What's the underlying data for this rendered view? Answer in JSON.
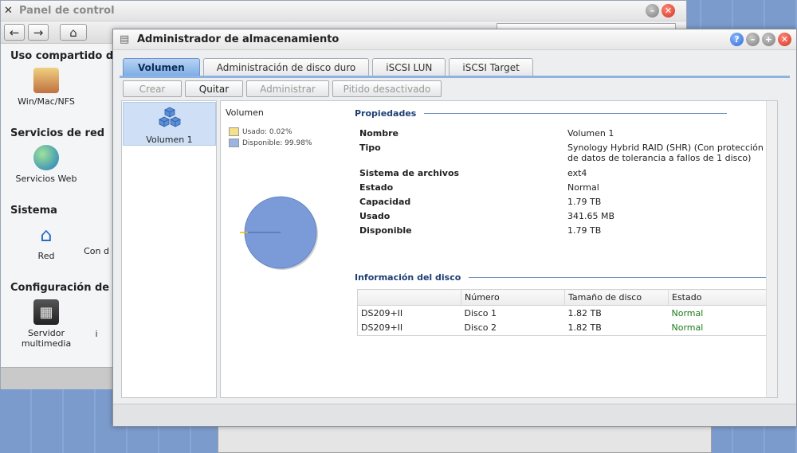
{
  "control_panel": {
    "title": "Panel de control",
    "sections": [
      {
        "label": "Uso compartido de",
        "items": [
          "Win/Mac/NFS"
        ]
      },
      {
        "label": "Servicios de red",
        "items": [
          "Servicios Web"
        ]
      },
      {
        "label": "Sistema",
        "items": [
          "Red",
          "Con d"
        ]
      },
      {
        "label": "Configuración de la",
        "items": [
          "Servidor multimedia",
          "i"
        ]
      }
    ]
  },
  "storage_manager": {
    "title": "Administrador de almacenamiento",
    "tabs": [
      "Volumen",
      "Administración de disco duro",
      "iSCSI LUN",
      "iSCSI Target"
    ],
    "actions": [
      {
        "label": "Crear",
        "enabled": false
      },
      {
        "label": "Quitar",
        "enabled": true
      },
      {
        "label": "Administrar",
        "enabled": false
      },
      {
        "label": "Pitido desactivado",
        "enabled": false
      }
    ],
    "volume_list": [
      "Volumen 1"
    ],
    "chart": {
      "title": "Volumen",
      "legend": [
        {
          "label": "Usado: 0.02%",
          "color": "#f7e08a"
        },
        {
          "label": "Disponible: 99.98%",
          "color": "#9ab5e0"
        }
      ]
    },
    "properties_title": "Propiedades",
    "properties": [
      {
        "key": "Nombre",
        "value": "Volumen 1"
      },
      {
        "key": "Tipo",
        "value": "Synology Hybrid RAID (SHR) (Con protección de datos de tolerancia a fallos de 1 disco)"
      },
      {
        "key": "Sistema de archivos",
        "value": "ext4"
      },
      {
        "key": "Estado",
        "value": "Normal"
      },
      {
        "key": "Capacidad",
        "value": "1.79 TB"
      },
      {
        "key": "Usado",
        "value": "341.65 MB"
      },
      {
        "key": "Disponible",
        "value": "1.79 TB"
      }
    ],
    "disk_info_title": "Información del disco",
    "disk_table": {
      "headers": [
        "",
        "Número",
        "Tamaño de disco",
        "Estado"
      ],
      "rows": [
        [
          "DS209+II",
          "Disco 1",
          "1.82 TB",
          "Normal"
        ],
        [
          "DS209+II",
          "Disco 2",
          "1.82 TB",
          "Normal"
        ]
      ]
    }
  },
  "chart_data": {
    "type": "pie",
    "title": "Volumen",
    "categories": [
      "Usado",
      "Disponible"
    ],
    "values": [
      0.02,
      99.98
    ],
    "colors": [
      "#f7e08a",
      "#7b9ad8"
    ]
  }
}
